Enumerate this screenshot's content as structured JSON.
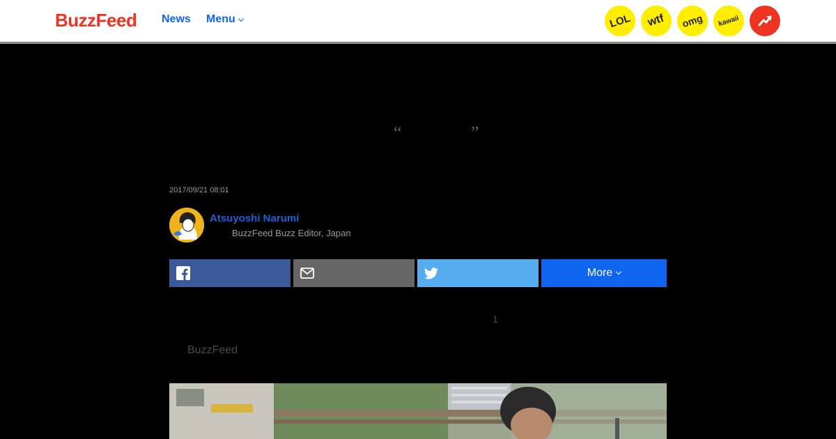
{
  "header": {
    "logo": "BuzzFeed",
    "nav": [
      {
        "label": "News"
      },
      {
        "label": "Menu"
      }
    ],
    "badges": [
      {
        "label": "LOL"
      },
      {
        "label": "wtf"
      },
      {
        "label": "omg"
      },
      {
        "label": "kawaii"
      }
    ],
    "trending_icon": "trending-arrow-icon"
  },
  "article": {
    "quote_open": "“",
    "quote_close": "”",
    "timestamp": "2017/09/21 08:01",
    "author": {
      "name": "Atsuyoshi Narumi",
      "role": "BuzzFeed Buzz Editor, Japan"
    },
    "share": {
      "facebook_icon": "facebook-icon",
      "email_icon": "email-icon",
      "twitter_icon": "twitter-icon",
      "more_label": "More"
    },
    "body_number": "1",
    "body_source": "BuzzFeed"
  },
  "colors": {
    "brand_red": "#ee3322",
    "link_blue": "#0f65ef",
    "badge_yellow": "#ffee00",
    "facebook": "#3b5998",
    "email": "#666666",
    "twitter": "#55acee"
  }
}
